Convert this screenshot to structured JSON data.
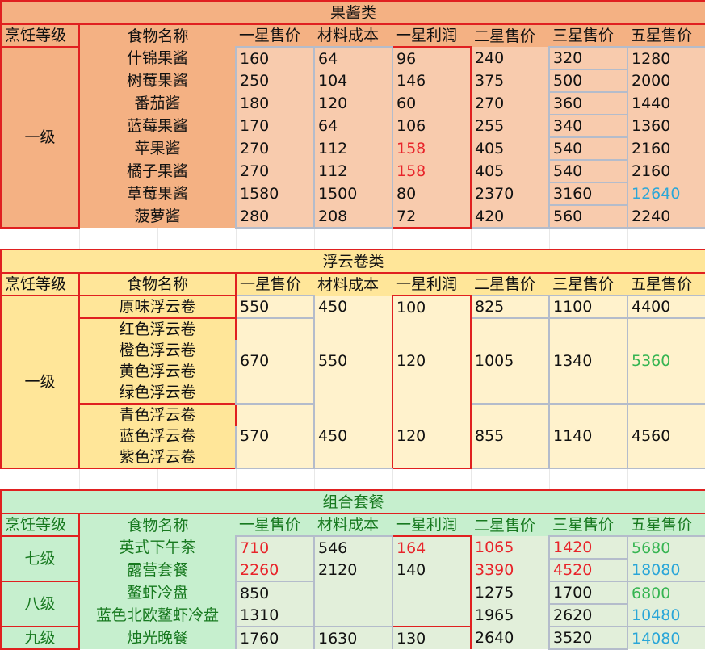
{
  "headers": {
    "grade": "烹饪等级",
    "name": "食物名称",
    "price1": "一星售价",
    "cost": "材料成本",
    "profit1": "一星利润",
    "price2": "二星售价",
    "price3": "三星售价",
    "price5": "五星售价"
  },
  "jam": {
    "title": "果酱类",
    "grade": "一级",
    "rows": [
      {
        "name": "什锦果酱",
        "p1": "160",
        "cost": "64",
        "profit": "96",
        "p2": "240",
        "p3": "320",
        "p5": "1280"
      },
      {
        "name": "树莓果酱",
        "p1": "250",
        "cost": "104",
        "profit": "146",
        "p2": "375",
        "p3": "500",
        "p5": "2000"
      },
      {
        "name": "番茄酱",
        "p1": "180",
        "cost": "120",
        "profit": "60",
        "p2": "270",
        "p3": "360",
        "p5": "1440"
      },
      {
        "name": "蓝莓果酱",
        "p1": "170",
        "cost": "64",
        "profit": "106",
        "p2": "255",
        "p3": "340",
        "p5": "1360"
      },
      {
        "name": "苹果酱",
        "p1": "270",
        "cost": "112",
        "profit": "158",
        "p2": "405",
        "p3": "540",
        "p5": "2160"
      },
      {
        "name": "橘子果酱",
        "p1": "270",
        "cost": "112",
        "profit": "158",
        "p2": "405",
        "p3": "540",
        "p5": "2160"
      },
      {
        "name": "草莓果酱",
        "p1": "1580",
        "cost": "1500",
        "profit": "80",
        "p2": "2370",
        "p3": "3160",
        "p5": "12640"
      },
      {
        "name": "菠萝酱",
        "p1": "280",
        "cost": "208",
        "profit": "72",
        "p2": "420",
        "p3": "560",
        "p5": "2240"
      }
    ]
  },
  "roll": {
    "title": "浮云卷类",
    "grade": "一级",
    "groups": [
      {
        "names": [
          "原味浮云卷"
        ],
        "p1": "550",
        "cost": "450",
        "profit": "100",
        "p2": "825",
        "p3": "1100",
        "p5": "4400"
      },
      {
        "names": [
          "红色浮云卷",
          "橙色浮云卷",
          "黄色浮云卷",
          "绿色浮云卷"
        ],
        "p1": "670",
        "cost": "550",
        "profit": "120",
        "p2": "1005",
        "p3": "1340",
        "p5": "5360"
      },
      {
        "names": [
          "青色浮云卷",
          "蓝色浮云卷",
          "紫色浮云卷"
        ],
        "p1": "570",
        "cost": "450",
        "profit": "120",
        "p2": "855",
        "p3": "1140",
        "p5": "4560"
      }
    ]
  },
  "combo": {
    "title": "组合套餐",
    "grades": [
      "七级",
      "八级",
      "九级"
    ],
    "rows": [
      {
        "name": "英式下午茶",
        "p1": "710",
        "cost": "546",
        "profit": "164",
        "p2": "1065",
        "p3": "1420",
        "p5": "5680"
      },
      {
        "name": "露营套餐",
        "p1": "2260",
        "cost": "2120",
        "profit": "140",
        "p2": "3390",
        "p3": "4520",
        "p5": "18080"
      },
      {
        "name": "鳌虾冷盘",
        "p1": "850",
        "p2": "1275",
        "p3": "1700",
        "p5": "6800"
      },
      {
        "name": "蓝色北欧鳌虾冷盘",
        "p1": "1310",
        "p2": "1965",
        "p3": "2620",
        "p5": "10480"
      },
      {
        "name": "烛光晚餐",
        "p1": "1760",
        "cost": "1630",
        "profit": "130",
        "p2": "2640",
        "p3": "3520",
        "p5": "14080"
      }
    ]
  },
  "colors": {
    "highlight_red": "#e8242a",
    "highlight_cyan": "#2aa6d8",
    "highlight_green": "#36b552"
  }
}
